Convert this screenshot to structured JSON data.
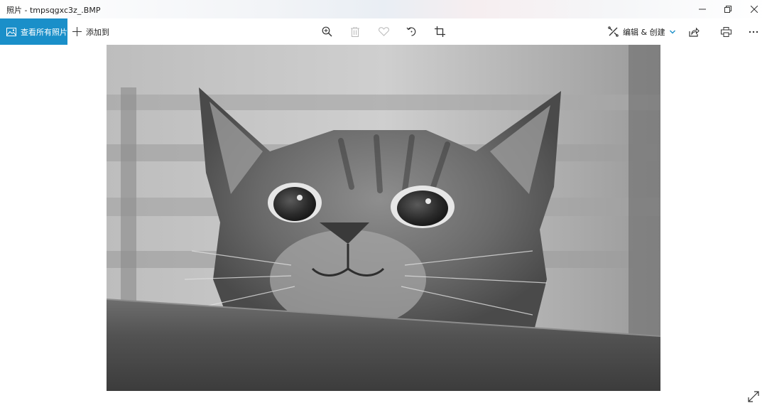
{
  "window": {
    "title": "照片 - tmpsqgxc3z_.BMP"
  },
  "toolbar": {
    "view_all_label": "查看所有照片",
    "add_to_label": "添加到",
    "edit_create_label": "编辑 & 创建",
    "tools": [
      "zoom-in-icon",
      "delete-icon",
      "favorite-icon",
      "rotate-icon",
      "crop-icon"
    ],
    "right_tools": [
      "share-icon",
      "print-icon",
      "more-icon"
    ]
  },
  "colors": {
    "accent": "#1a8fc9",
    "icon": "#333333",
    "icon_disabled": "#b8b8b8"
  }
}
